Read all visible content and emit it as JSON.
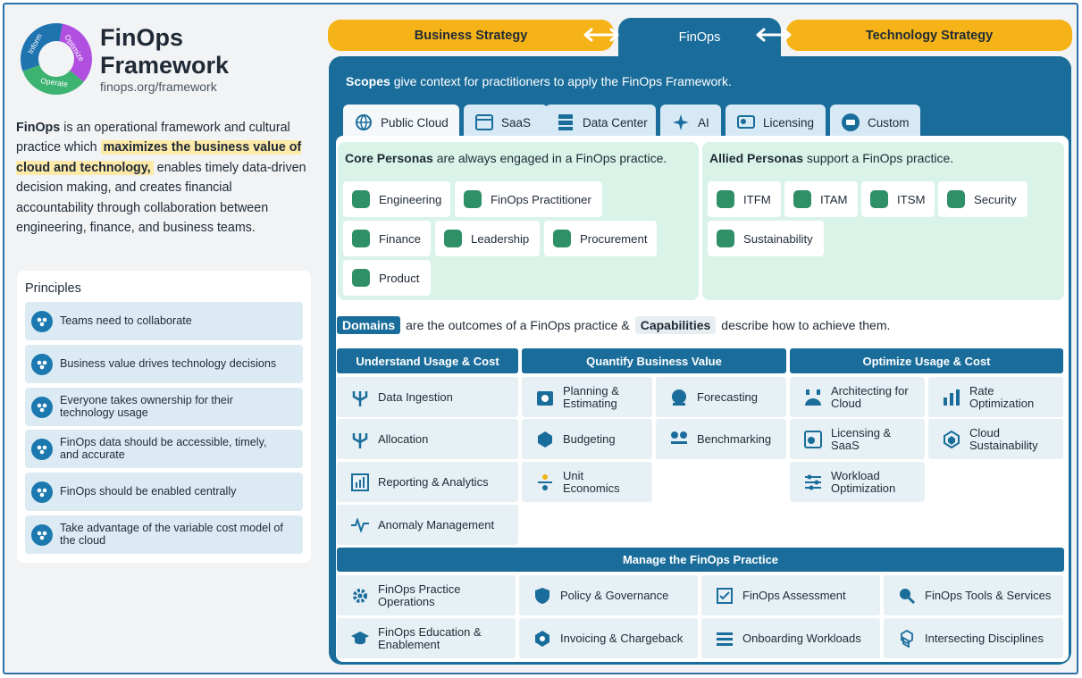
{
  "brand": {
    "title_line1": "FinOps",
    "title_line2": "Framework",
    "url": "finops.org/framework",
    "logo_labels": [
      "Inform",
      "Optimize",
      "Operate"
    ]
  },
  "intro": {
    "part1": "FinOps",
    "part2": " is an operational framework and cultural practice which ",
    "highlight": "maximizes the business value of cloud and technology,",
    "part3": " enables timely data-driven decision making, and creates financial accountability through collaboration between engineering, finance, and business teams."
  },
  "principles": {
    "title": "Principles",
    "items": [
      "Teams need to collaborate",
      "Business value drives technology decisions",
      "Everyone takes ownership for their technology usage",
      "FinOps data should be accessible, timely, and accurate",
      "FinOps should be enabled centrally",
      "Take advantage of the variable cost model of the cloud"
    ]
  },
  "top_tabs": {
    "left": "Business Strategy",
    "center": "FinOps",
    "right": "Technology Strategy"
  },
  "scopes": {
    "head_bold": "Scopes",
    "head_rest": " give context for practitioners to apply the FinOps Framework.",
    "tabs": [
      "Public Cloud",
      "SaaS",
      "Data Center",
      "AI",
      "Licensing",
      "Custom"
    ]
  },
  "core": {
    "head_bold": "Core Personas",
    "head_rest": " are always engaged in a FinOps practice.",
    "items": [
      "Engineering",
      "FinOps Practitioner",
      "Finance",
      "Leadership",
      "Procurement",
      "Product"
    ]
  },
  "allied": {
    "head_bold": "Allied Personas",
    "head_rest": " support a FinOps practice.",
    "items": [
      "ITFM",
      "ITAM",
      "ITSM",
      "Security",
      "Sustainability"
    ]
  },
  "domains_line": {
    "domains": "Domains",
    "mid": " are the outcomes of a FinOps practice & ",
    "capabilities": "Capabilities",
    "end": " describe how to achieve them."
  },
  "domains": [
    {
      "name": "Understand Usage & Cost",
      "caps": [
        "Data Ingestion",
        "Allocation",
        "Reporting & Analytics",
        "Anomaly Management"
      ]
    },
    {
      "name": "Quantify Business Value",
      "caps": [
        "Planning & Estimating",
        "Forecasting",
        "Budgeting",
        "Benchmarking",
        "Unit Economics"
      ]
    },
    {
      "name": "Optimize Usage & Cost",
      "caps": [
        "Architecting for Cloud",
        "Rate Optimization",
        "Licensing & SaaS",
        "Cloud Sustainability",
        "Workload Optimization"
      ]
    }
  ],
  "manage": {
    "name": "Manage the FinOps Practice",
    "caps": [
      "FinOps Practice Operations",
      "Policy & Governance",
      "FinOps Assessment",
      "FinOps Tools & Services",
      "FinOps Education & Enablement",
      "Invoicing & Chargeback",
      "Onboarding Workloads",
      "Intersecting Disciplines"
    ]
  },
  "colors": {
    "primary": "#1a6d9b",
    "accent_yellow": "#f6b317",
    "persona_bg": "#d9f3e8",
    "cap_bg": "#e6f0f5",
    "logo_blue": "#1f74b0",
    "logo_purple": "#b04fe0",
    "logo_green": "#3cb371"
  }
}
